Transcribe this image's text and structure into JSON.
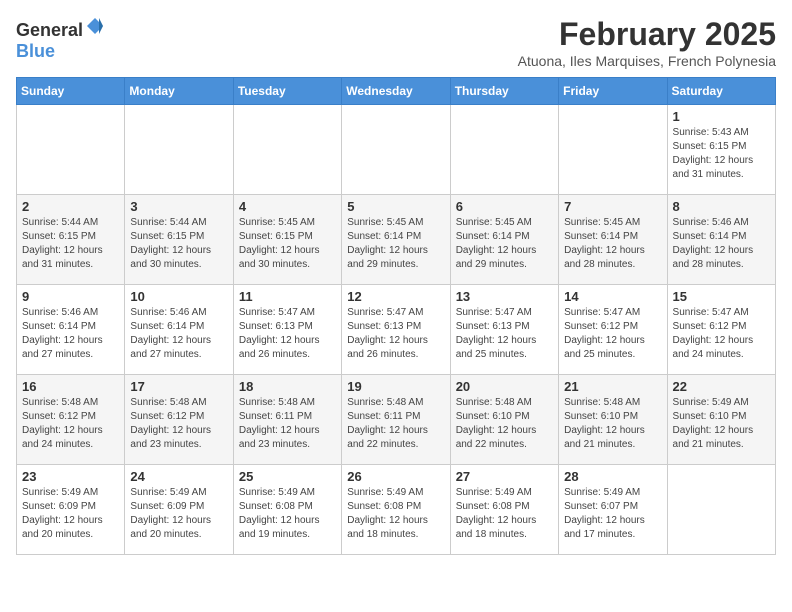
{
  "header": {
    "logo_general": "General",
    "logo_blue": "Blue",
    "month": "February 2025",
    "location": "Atuona, Iles Marquises, French Polynesia"
  },
  "days_of_week": [
    "Sunday",
    "Monday",
    "Tuesday",
    "Wednesday",
    "Thursday",
    "Friday",
    "Saturday"
  ],
  "weeks": [
    [
      {
        "day": "",
        "info": ""
      },
      {
        "day": "",
        "info": ""
      },
      {
        "day": "",
        "info": ""
      },
      {
        "day": "",
        "info": ""
      },
      {
        "day": "",
        "info": ""
      },
      {
        "day": "",
        "info": ""
      },
      {
        "day": "1",
        "info": "Sunrise: 5:43 AM\nSunset: 6:15 PM\nDaylight: 12 hours\nand 31 minutes."
      }
    ],
    [
      {
        "day": "2",
        "info": "Sunrise: 5:44 AM\nSunset: 6:15 PM\nDaylight: 12 hours\nand 31 minutes."
      },
      {
        "day": "3",
        "info": "Sunrise: 5:44 AM\nSunset: 6:15 PM\nDaylight: 12 hours\nand 30 minutes."
      },
      {
        "day": "4",
        "info": "Sunrise: 5:45 AM\nSunset: 6:15 PM\nDaylight: 12 hours\nand 30 minutes."
      },
      {
        "day": "5",
        "info": "Sunrise: 5:45 AM\nSunset: 6:14 PM\nDaylight: 12 hours\nand 29 minutes."
      },
      {
        "day": "6",
        "info": "Sunrise: 5:45 AM\nSunset: 6:14 PM\nDaylight: 12 hours\nand 29 minutes."
      },
      {
        "day": "7",
        "info": "Sunrise: 5:45 AM\nSunset: 6:14 PM\nDaylight: 12 hours\nand 28 minutes."
      },
      {
        "day": "8",
        "info": "Sunrise: 5:46 AM\nSunset: 6:14 PM\nDaylight: 12 hours\nand 28 minutes."
      }
    ],
    [
      {
        "day": "9",
        "info": "Sunrise: 5:46 AM\nSunset: 6:14 PM\nDaylight: 12 hours\nand 27 minutes."
      },
      {
        "day": "10",
        "info": "Sunrise: 5:46 AM\nSunset: 6:14 PM\nDaylight: 12 hours\nand 27 minutes."
      },
      {
        "day": "11",
        "info": "Sunrise: 5:47 AM\nSunset: 6:13 PM\nDaylight: 12 hours\nand 26 minutes."
      },
      {
        "day": "12",
        "info": "Sunrise: 5:47 AM\nSunset: 6:13 PM\nDaylight: 12 hours\nand 26 minutes."
      },
      {
        "day": "13",
        "info": "Sunrise: 5:47 AM\nSunset: 6:13 PM\nDaylight: 12 hours\nand 25 minutes."
      },
      {
        "day": "14",
        "info": "Sunrise: 5:47 AM\nSunset: 6:12 PM\nDaylight: 12 hours\nand 25 minutes."
      },
      {
        "day": "15",
        "info": "Sunrise: 5:47 AM\nSunset: 6:12 PM\nDaylight: 12 hours\nand 24 minutes."
      }
    ],
    [
      {
        "day": "16",
        "info": "Sunrise: 5:48 AM\nSunset: 6:12 PM\nDaylight: 12 hours\nand 24 minutes."
      },
      {
        "day": "17",
        "info": "Sunrise: 5:48 AM\nSunset: 6:12 PM\nDaylight: 12 hours\nand 23 minutes."
      },
      {
        "day": "18",
        "info": "Sunrise: 5:48 AM\nSunset: 6:11 PM\nDaylight: 12 hours\nand 23 minutes."
      },
      {
        "day": "19",
        "info": "Sunrise: 5:48 AM\nSunset: 6:11 PM\nDaylight: 12 hours\nand 22 minutes."
      },
      {
        "day": "20",
        "info": "Sunrise: 5:48 AM\nSunset: 6:10 PM\nDaylight: 12 hours\nand 22 minutes."
      },
      {
        "day": "21",
        "info": "Sunrise: 5:48 AM\nSunset: 6:10 PM\nDaylight: 12 hours\nand 21 minutes."
      },
      {
        "day": "22",
        "info": "Sunrise: 5:49 AM\nSunset: 6:10 PM\nDaylight: 12 hours\nand 21 minutes."
      }
    ],
    [
      {
        "day": "23",
        "info": "Sunrise: 5:49 AM\nSunset: 6:09 PM\nDaylight: 12 hours\nand 20 minutes."
      },
      {
        "day": "24",
        "info": "Sunrise: 5:49 AM\nSunset: 6:09 PM\nDaylight: 12 hours\nand 20 minutes."
      },
      {
        "day": "25",
        "info": "Sunrise: 5:49 AM\nSunset: 6:08 PM\nDaylight: 12 hours\nand 19 minutes."
      },
      {
        "day": "26",
        "info": "Sunrise: 5:49 AM\nSunset: 6:08 PM\nDaylight: 12 hours\nand 18 minutes."
      },
      {
        "day": "27",
        "info": "Sunrise: 5:49 AM\nSunset: 6:08 PM\nDaylight: 12 hours\nand 18 minutes."
      },
      {
        "day": "28",
        "info": "Sunrise: 5:49 AM\nSunset: 6:07 PM\nDaylight: 12 hours\nand 17 minutes."
      },
      {
        "day": "",
        "info": ""
      }
    ]
  ]
}
